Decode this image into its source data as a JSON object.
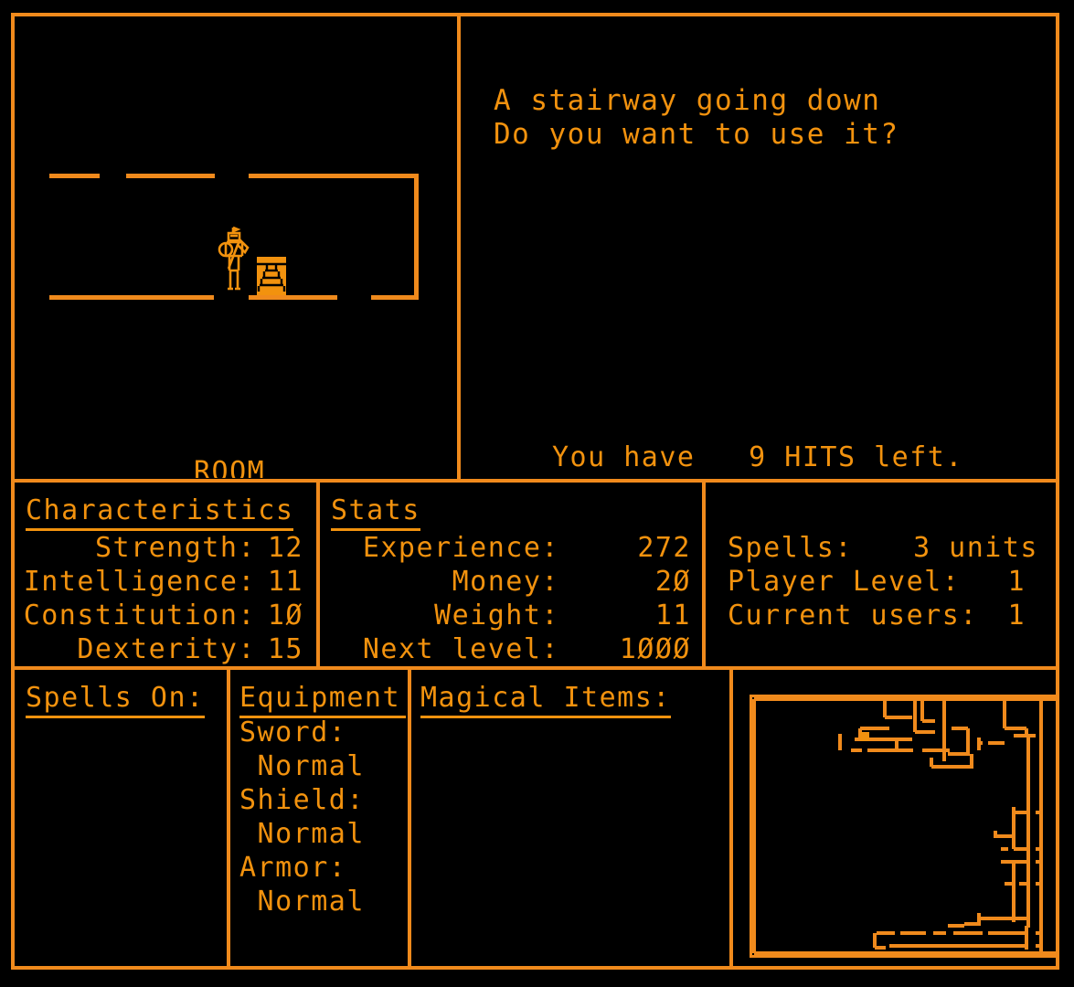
{
  "theme": {
    "background": "#000000",
    "foreground": "#F2920E",
    "border": "#F08A1C"
  },
  "room_view": {
    "label": "ROOM",
    "player_icon": "knight-sprite",
    "feature_icon": "stairs-down-icon"
  },
  "message": {
    "line1": "A stairway going down",
    "line2": "Do you want to use it?"
  },
  "status": {
    "hits_text": "You have   9 HITS left.",
    "hits_value": "9"
  },
  "characteristics": {
    "title": "Characteristics",
    "rows": [
      {
        "label": "Strength:",
        "value": "12"
      },
      {
        "label": "Intelligence:",
        "value": "11"
      },
      {
        "label": "Constitution:",
        "value": "1Ø"
      },
      {
        "label": "Dexterity:",
        "value": "15"
      }
    ]
  },
  "stats": {
    "title": "Stats",
    "rows": [
      {
        "label": "Experience:",
        "value": "272"
      },
      {
        "label": "Money:",
        "value": "2Ø"
      },
      {
        "label": "Weight:",
        "value": "11"
      },
      {
        "label": "Next level:",
        "value": "1ØØØ"
      }
    ]
  },
  "player_info": {
    "rows": [
      {
        "label": "Spells:",
        "value": "3 units"
      },
      {
        "label": "Player Level:",
        "value": "1"
      },
      {
        "label": "Current users:",
        "value": "1"
      }
    ]
  },
  "spells_on": {
    "title": "Spells On:",
    "items": []
  },
  "equipment": {
    "title": "Equipment:",
    "items": [
      {
        "slot": "Sword:",
        "quality": " Normal"
      },
      {
        "slot": "Shield:",
        "quality": " Normal"
      },
      {
        "slot": "Armor:",
        "quality": " Normal"
      }
    ]
  },
  "magical_items": {
    "title": "Magical Items:",
    "items": []
  },
  "minimap": {
    "name": "dungeon-minimap",
    "player_marker": "filled-square"
  }
}
